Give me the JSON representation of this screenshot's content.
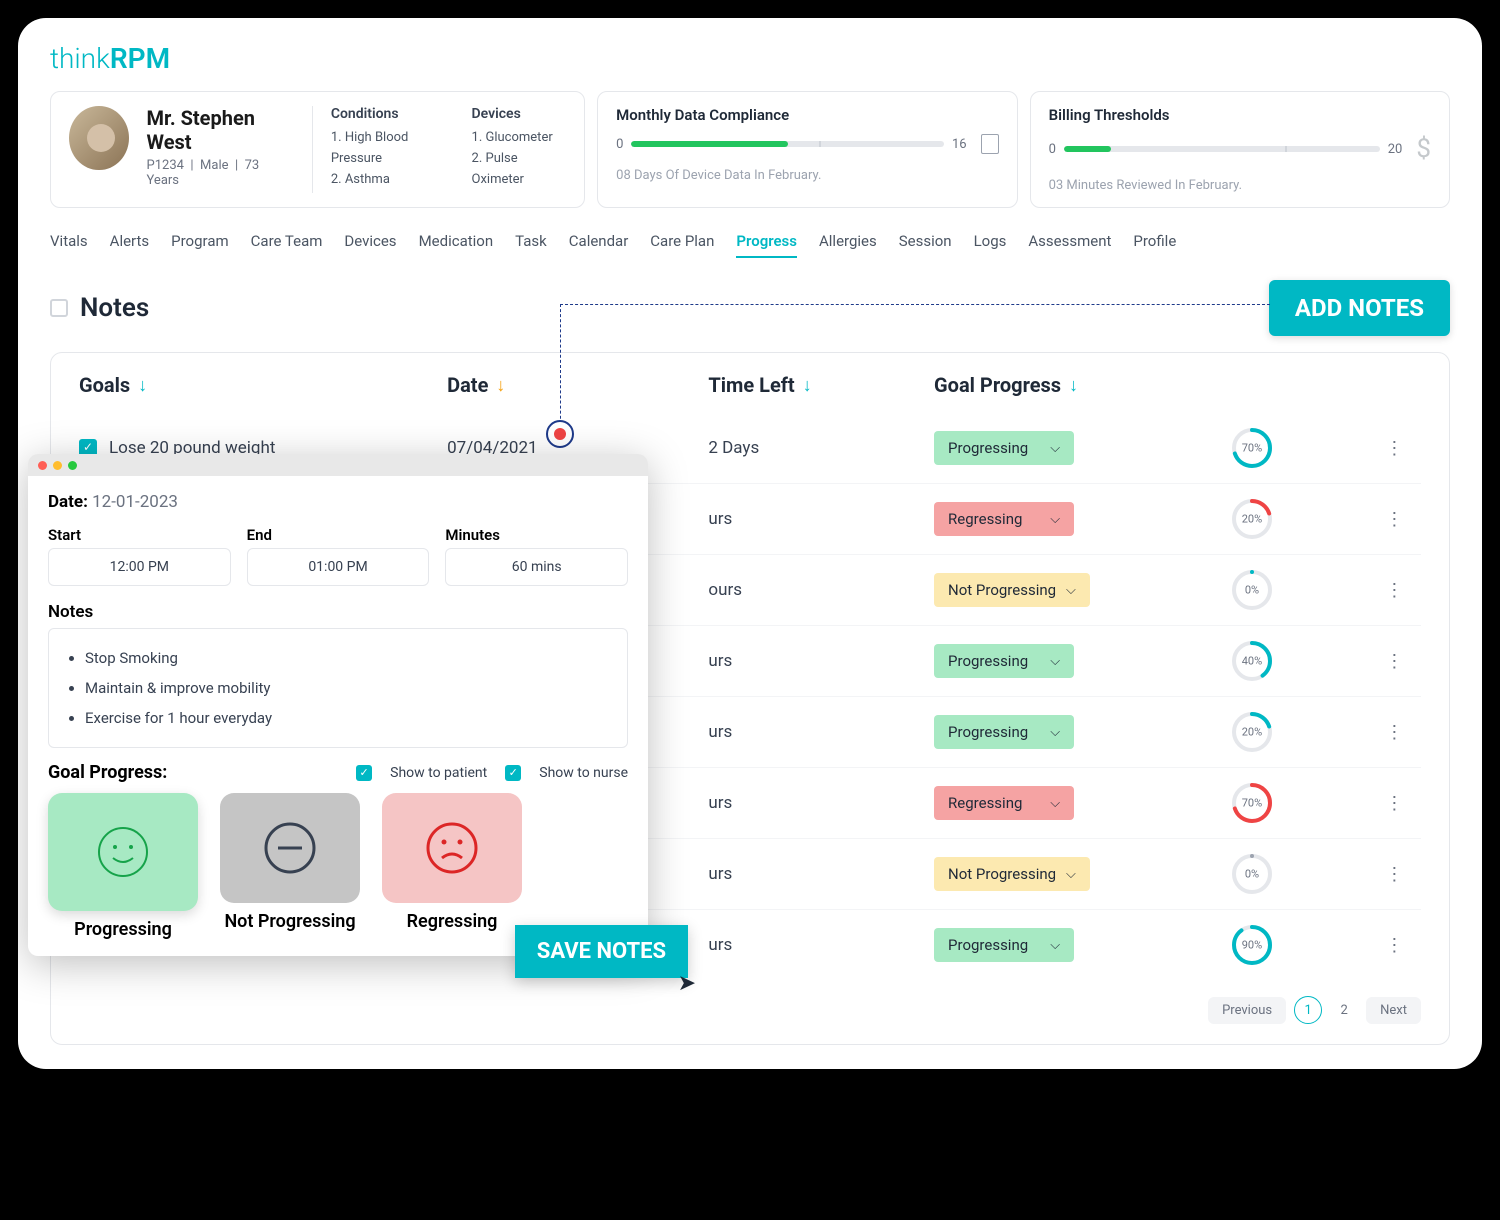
{
  "logo": {
    "thin": "think",
    "bold": "RPM"
  },
  "patient": {
    "name": "Mr. Stephen West",
    "id": "P1234",
    "gender": "Male",
    "age": "73 Years",
    "conditions_label": "Conditions",
    "conditions": [
      "1. High Blood Pressure",
      "2. Asthma"
    ],
    "devices_label": "Devices",
    "devices": [
      "1. Glucometer",
      "2. Pulse Oximeter"
    ]
  },
  "compliance": {
    "title": "Monthly Data Compliance",
    "min": "0",
    "max": "16",
    "fill_pct": 50,
    "sub": "08 Days Of Device Data In February."
  },
  "billing": {
    "title": "Billing Thresholds",
    "min": "0",
    "max": "20",
    "fill_pct": 15,
    "sub": "03 Minutes Reviewed In February."
  },
  "tabs": [
    "Vitals",
    "Alerts",
    "Program",
    "Care Team",
    "Devices",
    "Medication",
    "Task",
    "Calendar",
    "Care Plan",
    "Progress",
    "Allergies",
    "Session",
    "Logs",
    "Assessment",
    "Profile"
  ],
  "active_tab": "Progress",
  "notes_header": "Notes",
  "add_notes_label": "ADD NOTES",
  "columns": {
    "goals": "Goals",
    "date": "Date",
    "time": "Time Left",
    "gp": "Goal Progress"
  },
  "rows": [
    {
      "goal": "Lose 20 pound weight",
      "date": "07/04/2021",
      "time": "2 Days",
      "status": "Progressing",
      "type": "prog",
      "pct": 70,
      "color": "#00b8c4",
      "checked": true
    },
    {
      "goal": "",
      "date": "",
      "time": "urs",
      "status": "Regressing",
      "type": "reg",
      "pct": 20,
      "color": "#ef4444"
    },
    {
      "goal": "",
      "date": "",
      "time": "ours",
      "status": "Not Progressing",
      "type": "notp",
      "pct": 0,
      "color": "#00b8c4"
    },
    {
      "goal": "",
      "date": "",
      "time": "urs",
      "status": "Progressing",
      "type": "prog",
      "pct": 40,
      "color": "#00b8c4"
    },
    {
      "goal": "",
      "date": "",
      "time": "urs",
      "status": "Progressing",
      "type": "prog",
      "pct": 20,
      "color": "#00b8c4"
    },
    {
      "goal": "",
      "date": "",
      "time": "urs",
      "status": "Regressing",
      "type": "reg",
      "pct": 70,
      "color": "#ef4444"
    },
    {
      "goal": "",
      "date": "",
      "time": "urs",
      "status": "Not Progressing",
      "type": "notp",
      "pct": 0,
      "color": "#9ca3af"
    },
    {
      "goal": "",
      "date": "",
      "time": "urs",
      "status": "Progressing",
      "type": "prog",
      "pct": 90,
      "color": "#00b8c4"
    }
  ],
  "pager": {
    "prev": "Previous",
    "next": "Next",
    "pages": [
      "1",
      "2"
    ],
    "active": "1"
  },
  "modal": {
    "date_label": "Date:",
    "date": "12-01-2023",
    "start": {
      "label": "Start",
      "value": "12:00 PM"
    },
    "end": {
      "label": "End",
      "value": "01:00 PM"
    },
    "mins": {
      "label": "Minutes",
      "value": "60 mins"
    },
    "notes_label": "Notes",
    "notes": [
      "Stop Smoking",
      "Maintain & improve mobility",
      "Exercise for 1 hour everyday"
    ],
    "gp_label": "Goal Progress:",
    "show_patient": "Show to patient",
    "show_nurse": "Show to nurse",
    "faces": {
      "prog": "Progressing",
      "notp": "Not Progressing",
      "reg": "Regressing"
    },
    "save": "SAVE NOTES"
  }
}
